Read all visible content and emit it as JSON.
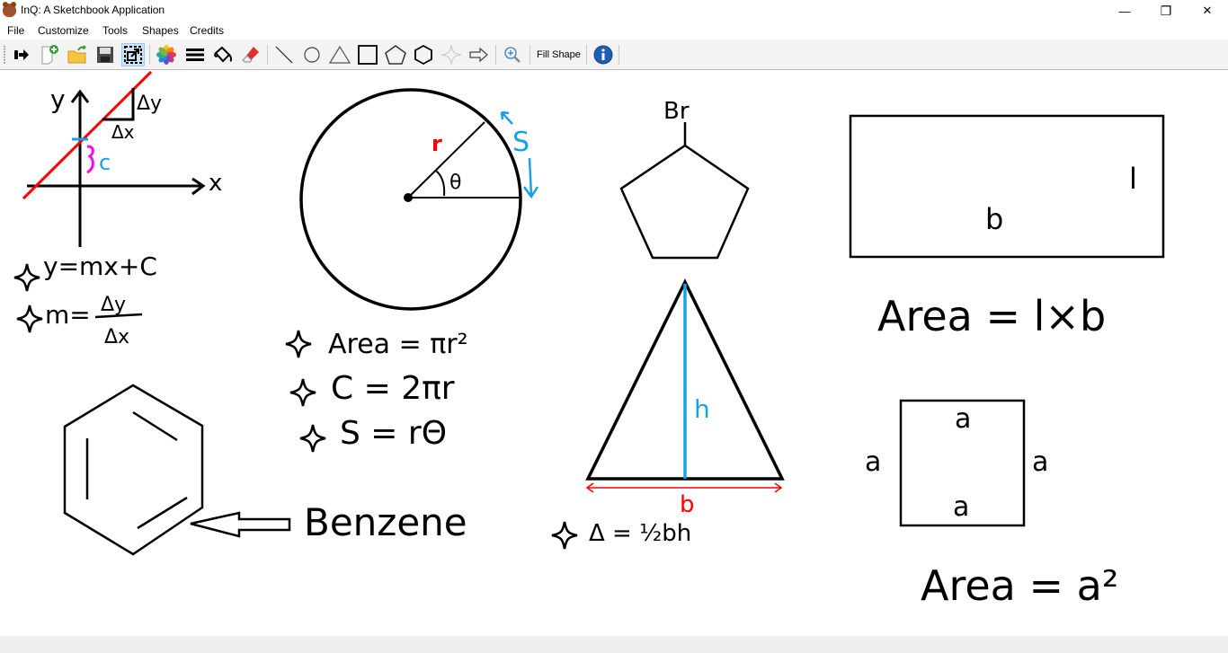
{
  "window": {
    "title": "InQ: A Sketchbook Application",
    "controls": {
      "minimize": "—",
      "restore": "❐",
      "close": "✕"
    }
  },
  "menu": [
    "File",
    "Customize",
    "Tools",
    "Shapes",
    "Credits"
  ],
  "toolbar": {
    "items": [
      {
        "name": "exit-icon"
      },
      {
        "name": "new-file-icon"
      },
      {
        "name": "open-folder-icon"
      },
      {
        "name": "save-icon"
      },
      {
        "name": "resize-canvas-icon",
        "active": true
      },
      {
        "name": "color-palette-icon"
      },
      {
        "name": "line-thickness-icon"
      },
      {
        "name": "fill-bucket-icon"
      },
      {
        "name": "eraser-icon"
      },
      {
        "name": "line-tool-icon"
      },
      {
        "name": "circle-tool-icon"
      },
      {
        "name": "triangle-tool-icon"
      },
      {
        "name": "rectangle-tool-icon"
      },
      {
        "name": "pentagon-tool-icon"
      },
      {
        "name": "hexagon-tool-icon"
      },
      {
        "name": "star-tool-icon"
      },
      {
        "name": "arrow-tool-icon"
      },
      {
        "name": "zoom-icon"
      },
      {
        "name": "info-icon"
      }
    ],
    "fill_shape_label": "Fill Shape"
  },
  "canvas": {
    "colors": {
      "ink": "#000000",
      "red": "#ff0000",
      "blue": "#1aa0e8",
      "magenta": "#ff00ff"
    },
    "line_graph": {
      "y_label": "y",
      "x_label": "x",
      "dy": "Δy",
      "dx": "Δx",
      "c": "c",
      "eq1": "y=mx+C",
      "eq2_left": "m=",
      "eq2_num": "Δy",
      "eq2_den": "Δx"
    },
    "circle": {
      "radius_label": "r",
      "angle_label": "θ",
      "arc_label": "S",
      "formulas": [
        "Area = πr²",
        "C = 2πr",
        "S = rΘ"
      ]
    },
    "pentagon": {
      "substituent": "Br"
    },
    "triangle": {
      "height_label": "h",
      "base_label": "b",
      "formula": "Δ = ½bh"
    },
    "rectangle": {
      "length_label": "l",
      "breadth_label": "b",
      "formula": "Area = l×b"
    },
    "square": {
      "side_label": "a",
      "formula": "Area = a²"
    },
    "benzene": {
      "label": "Benzene"
    }
  }
}
